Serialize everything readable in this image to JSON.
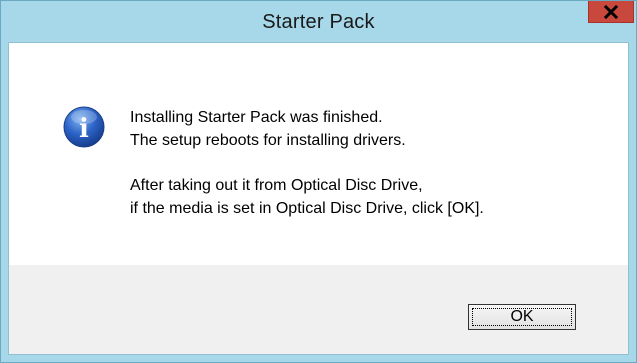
{
  "window": {
    "title": "Starter Pack",
    "close_icon": "close-x-icon",
    "colors": {
      "frame": "#a6d8ea",
      "close_button": "#c9483d",
      "footer": "#f0f0f0"
    }
  },
  "dialog": {
    "icon": "information-icon",
    "icon_glyph": "i",
    "lines": [
      "Installing Starter Pack was finished.",
      "The setup reboots for installing drivers.",
      "After taking out it from Optical Disc Drive,",
      "if the media is set in Optical Disc Drive, click [OK]."
    ]
  },
  "buttons": {
    "ok_label": "OK"
  }
}
